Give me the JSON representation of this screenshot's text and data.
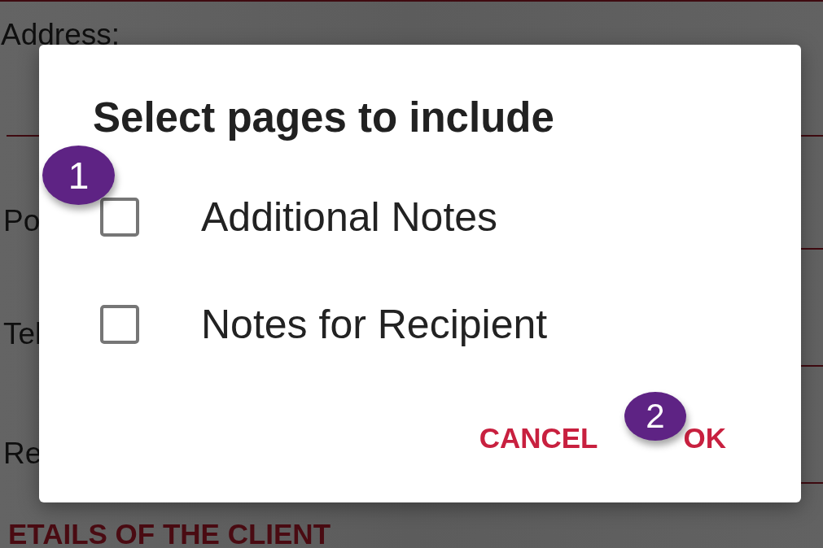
{
  "background_form": {
    "fields": [
      {
        "label": "Address:"
      },
      {
        "label": "Po"
      },
      {
        "label": "Tel"
      },
      {
        "label": "Re"
      }
    ],
    "section_heading": "ETAILS OF THE CLIENT"
  },
  "dialog": {
    "title": "Select pages to include",
    "options": [
      {
        "label": "Additional Notes",
        "checked": false
      },
      {
        "label": "Notes for Recipient",
        "checked": false
      }
    ],
    "buttons": [
      {
        "label": "CANCEL"
      },
      {
        "label": "OK"
      }
    ]
  },
  "callouts": [
    {
      "number": "1"
    },
    {
      "number": "2"
    }
  ]
}
